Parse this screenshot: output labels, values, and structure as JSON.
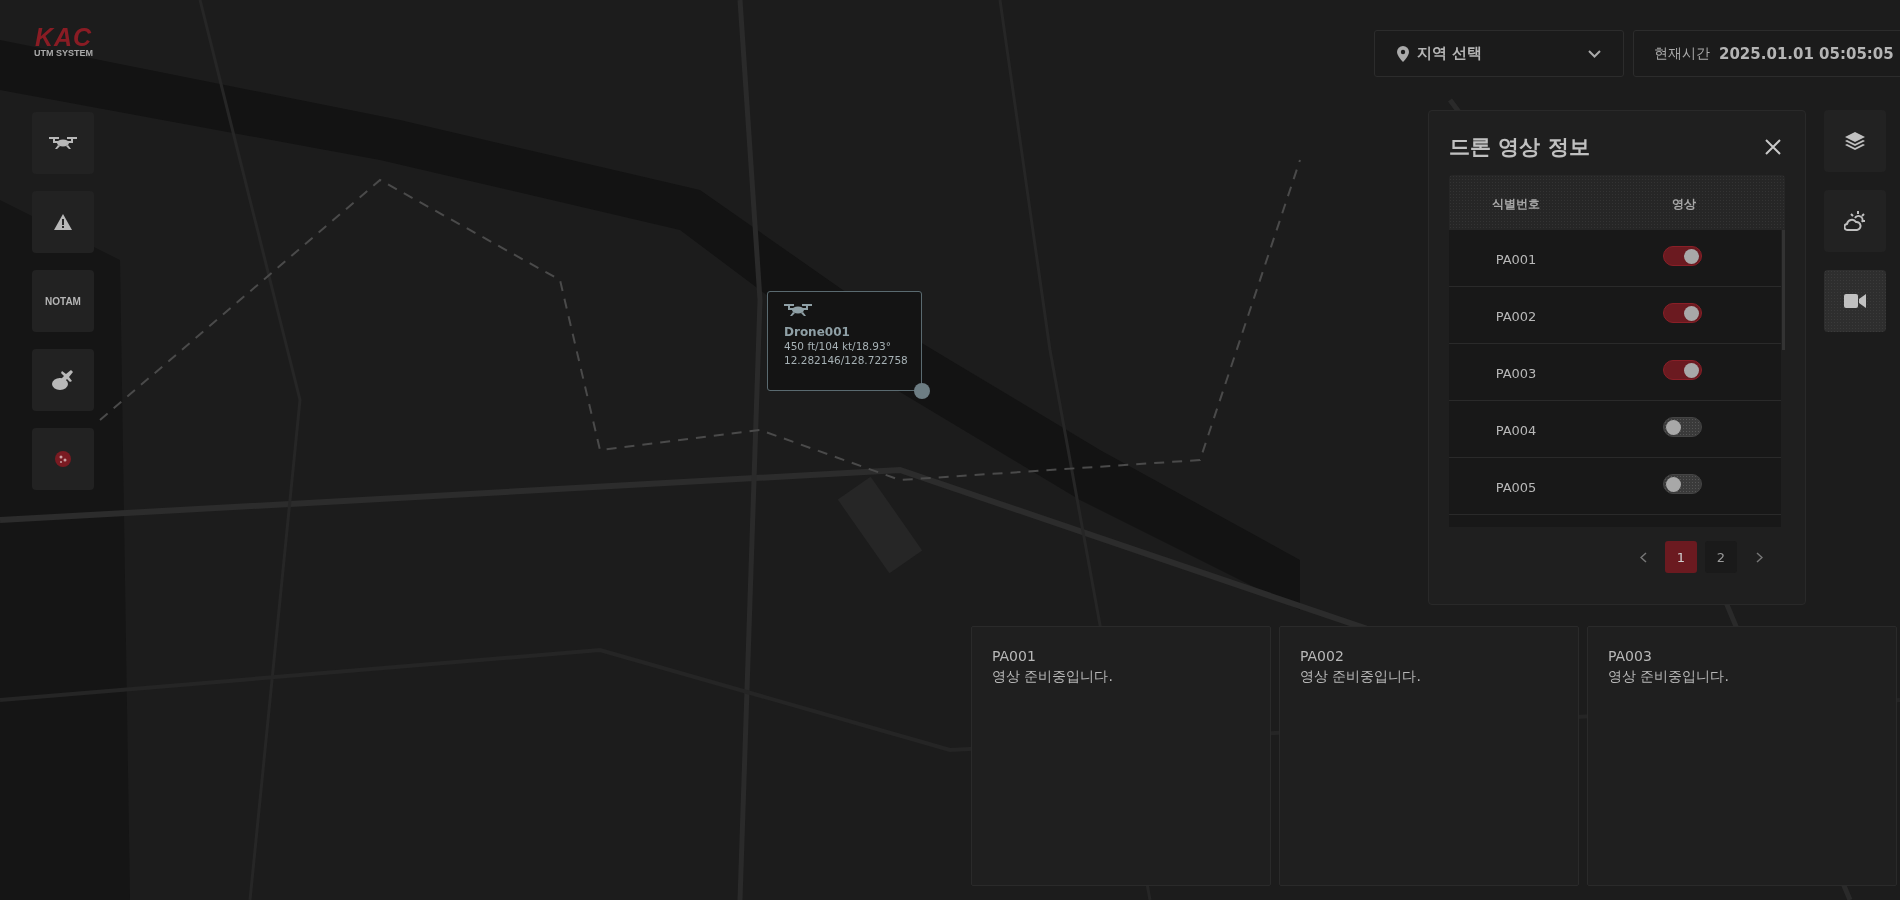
{
  "logo": {
    "mark": "KAC",
    "subtitle": "UTM SYSTEM"
  },
  "left_toolbar": [
    {
      "kind": "drone",
      "selected": false
    },
    {
      "kind": "warning",
      "selected": false
    },
    {
      "kind": "text",
      "label": "NOTAM",
      "selected": false
    },
    {
      "kind": "weather-plane",
      "selected": false
    },
    {
      "kind": "virus",
      "selected": false
    }
  ],
  "region_select": {
    "value": "지역 선택"
  },
  "clock": {
    "label": "현재시간",
    "value": "2025.01.01 05:05:05"
  },
  "right_toolbar": [
    {
      "kind": "layers",
      "selected": false
    },
    {
      "kind": "weather",
      "selected": false
    },
    {
      "kind": "video",
      "selected": true
    }
  ],
  "video_panel": {
    "title": "드론 영상 정보",
    "table": {
      "columns": [
        "식별번호",
        "영상"
      ],
      "rows": [
        {
          "id": "PA001",
          "on": true
        },
        {
          "id": "PA002",
          "on": true
        },
        {
          "id": "PA003",
          "on": true
        },
        {
          "id": "PA004",
          "on": false
        },
        {
          "id": "PA005",
          "on": false
        }
      ]
    },
    "pagination": {
      "pages": [
        {
          "label": "1",
          "selected": true
        },
        {
          "label": "2",
          "selected": false
        }
      ]
    }
  },
  "drone_popup": {
    "name": "Drone001",
    "flight": "450 ft/104 kt/18.93°",
    "position": "12.282146/128.722758"
  },
  "video_cards": [
    {
      "id": "PA001",
      "message": "영상 준비중입니다."
    },
    {
      "id": "PA002",
      "message": "영상 준비중입니다."
    },
    {
      "id": "PA003",
      "message": "영상 준비중입니다."
    }
  ]
}
